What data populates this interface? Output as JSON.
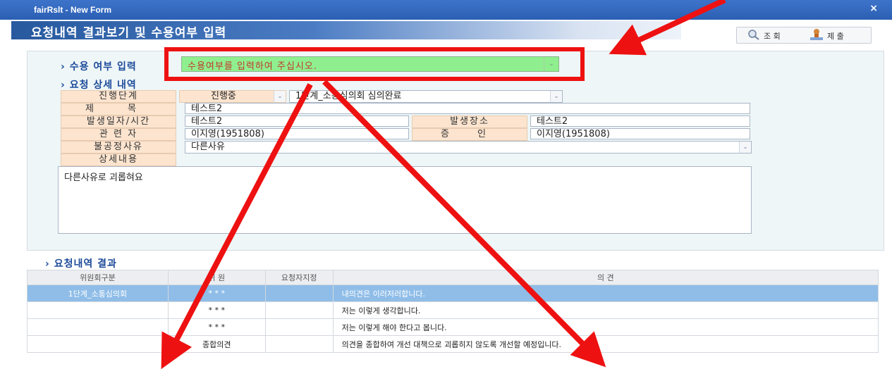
{
  "window": {
    "title": "fairRslt - New Form",
    "close": "×"
  },
  "header": {
    "title": "요청내역 결과보기 및 수용여부 입력",
    "search_label": "조 회",
    "submit_label": "제 출"
  },
  "accept": {
    "section_label": "수용 여부 입력",
    "placeholder": "수용여부를 입력하여 주십시오.",
    "bg": "#8fef8f",
    "text_color": "#c0392b"
  },
  "detail": {
    "section_label": "요청 상세 내역",
    "stage_label": "진행단계",
    "stage_status": "진행중",
    "stage_value": "1단계_소통심의회 심의완료",
    "title_label": "제 목",
    "title_value": "테스트2",
    "datetime_label": "발생일자/시간",
    "datetime_value": "테스트2",
    "place_label": "발생장소",
    "place_value": "테스트2",
    "person_label": "관 련 자",
    "person_value": "이지영(1951808)",
    "witness_label": "증 인",
    "witness_value": "이지영(1951808)",
    "reason_label": "불공정사유",
    "reason_value": "다른사유",
    "content_label": "상세내용",
    "content_value": "다른사유로 괴롭혀요"
  },
  "result": {
    "section_label": "요청내역 결과",
    "columns": [
      "위원회구분",
      "위 원",
      "요청자지정",
      "의 견"
    ],
    "rows": [
      {
        "committee": "1단계_소통심의회",
        "member": "* * *",
        "designated": "",
        "opinion": "내의견은 이러저러합니다."
      },
      {
        "committee": "",
        "member": "* * *",
        "designated": "",
        "opinion": "저는 이렇게 생각합니다."
      },
      {
        "committee": "",
        "member": "* * *",
        "designated": "",
        "opinion": "저는 이렇게 해야 한다고 봅니다."
      },
      {
        "committee": "",
        "member": "종합의견",
        "designated": "",
        "opinion": "의견을 종합하여 개선 대책으로 괴롭히지 않도록 개선할 예정입니다."
      }
    ]
  },
  "annotation_color": "#ee1111"
}
